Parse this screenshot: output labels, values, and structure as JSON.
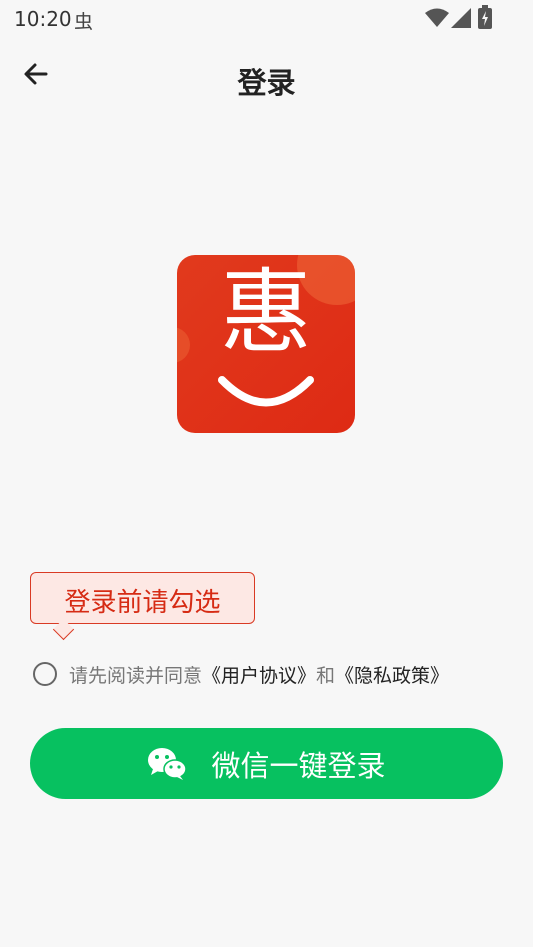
{
  "status_bar": {
    "time": "10:20",
    "app_icon_glyph": "虫"
  },
  "header": {
    "title": "登录",
    "back_icon": "arrow-left-icon"
  },
  "logo": {
    "char": "惠",
    "brand_color": "#e0321a"
  },
  "tooltip": {
    "text": "登录前请勾选"
  },
  "agreement": {
    "prefix": "请先阅读并同意",
    "user_agreement": "《用户协议》",
    "conjunction": "和",
    "privacy_policy": "《隐私政策》",
    "checked": false
  },
  "login_button": {
    "label": "微信一键登录",
    "color": "#07c160",
    "icon": "wechat-icon"
  }
}
